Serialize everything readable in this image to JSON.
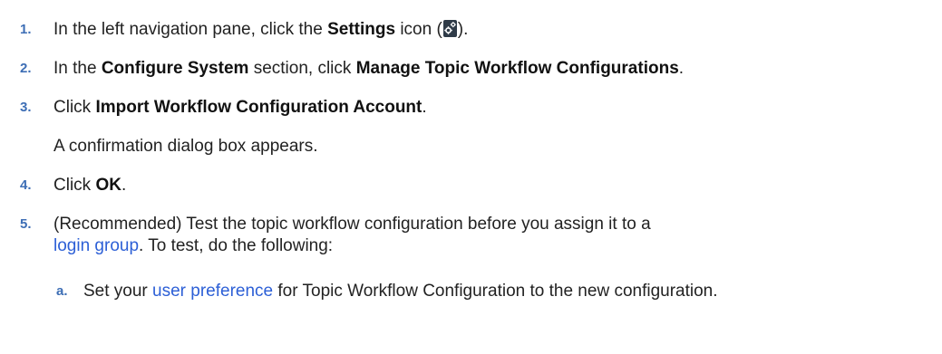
{
  "steps": [
    {
      "num": "1.",
      "t1": "In the left navigation pane, click the ",
      "b1": "Settings",
      "t2": " icon (",
      "icon": "settings-gear-icon",
      "t3": ")."
    },
    {
      "num": "2.",
      "t1": "In the ",
      "b1": "Configure System",
      "t2": " section, click ",
      "b2": "Manage Topic Workflow Configurations",
      "t3": "."
    },
    {
      "num": "3.",
      "t1": "Click ",
      "b1": "Import Workflow Configuration Account",
      "t2": ".",
      "note": "A confirmation dialog box appears."
    },
    {
      "num": "4.",
      "t1": "Click ",
      "b1": "OK",
      "t2": "."
    },
    {
      "num": "5.",
      "line1": "(Recommended) Test the topic workflow configuration before you assign it to a",
      "link": "login group",
      "t2": ". To test, do the following:",
      "substeps": [
        {
          "num": "a.",
          "t1": "Set your ",
          "link": "user preference",
          "t2": " for Topic Workflow Configuration to the new configuration."
        }
      ]
    }
  ],
  "colors": {
    "step_number": "#3d6eb5",
    "link": "#2c5fd6",
    "icon_bg": "#2f3b48"
  }
}
